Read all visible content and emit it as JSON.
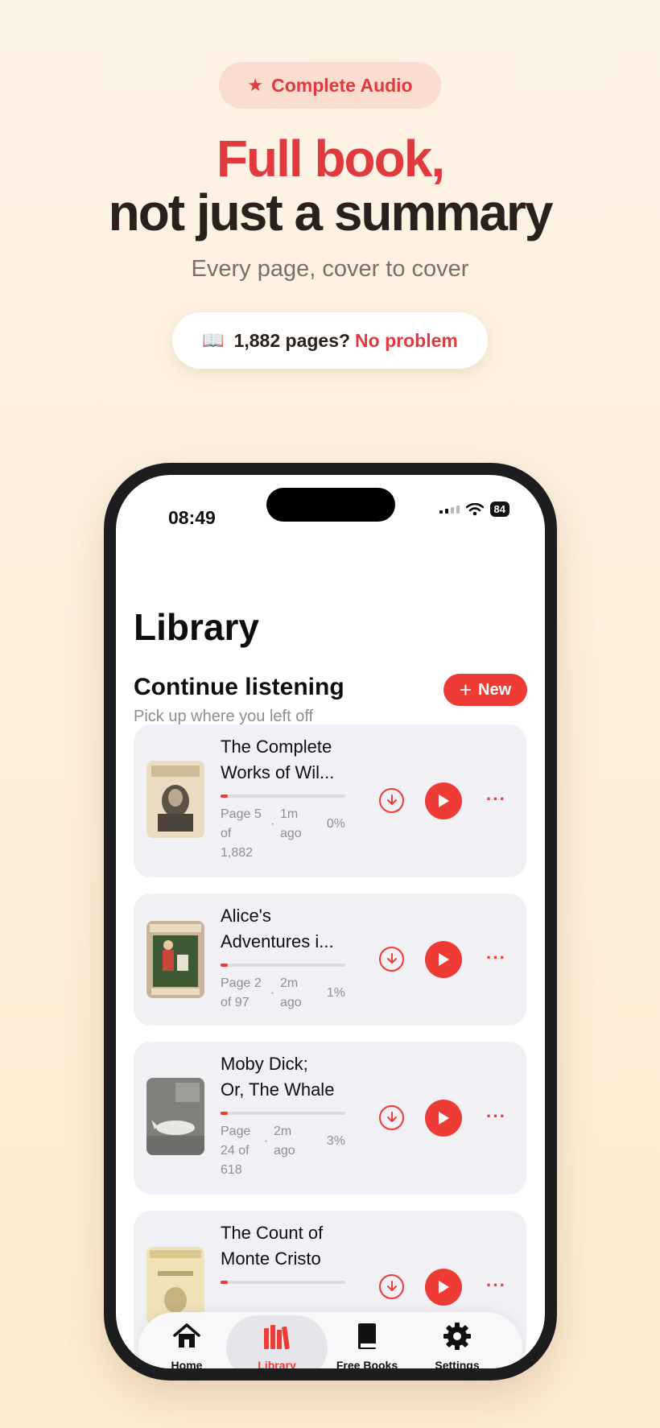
{
  "promo": {
    "badge_label": "Complete Audio",
    "headline_line1": "Full book,",
    "headline_line2": "not just a summary",
    "subheadline": "Every page, cover to cover",
    "pill_text": "1,882 pages?",
    "pill_highlight": "No problem",
    "accent_color": "#e0393e"
  },
  "status_bar": {
    "time": "08:49",
    "battery": "84"
  },
  "library": {
    "title": "Library",
    "section_title": "Continue listening",
    "section_subtitle": "Pick up where you left off",
    "new_button_label": "New"
  },
  "books": [
    {
      "title_line1": "The Complete",
      "title_line2": "Works of Wil...",
      "pages_line1": "Page 5",
      "pages_line2": "of",
      "pages_line3": "1,882",
      "ago_line1": "1m",
      "ago_line2": "ago",
      "percent": "0%",
      "progress": 0.06
    },
    {
      "title_line1": "Alice's",
      "title_line2": "Adventures i...",
      "pages_line1": "Page 2",
      "pages_line2": "of 97",
      "ago_line1": "2m",
      "ago_line2": "ago",
      "percent": "1%",
      "progress": 0.06
    },
    {
      "title_line1": "Moby Dick;",
      "title_line2": "Or, The Whale",
      "pages_line1": "Page",
      "pages_line2": "24 of",
      "pages_line3": "618",
      "ago_line1": "2m",
      "ago_line2": "ago",
      "percent": "3%",
      "progress": 0.06
    },
    {
      "title_line1": "The Count of",
      "title_line2": "Monte Cristo",
      "progress": 0.06
    }
  ],
  "tabs": [
    {
      "label": "Home",
      "icon": "home-icon"
    },
    {
      "label": "Library",
      "icon": "library-icon",
      "active": true
    },
    {
      "label": "Free Books",
      "icon": "book-icon"
    },
    {
      "label": "Settings",
      "icon": "gear-icon"
    }
  ]
}
